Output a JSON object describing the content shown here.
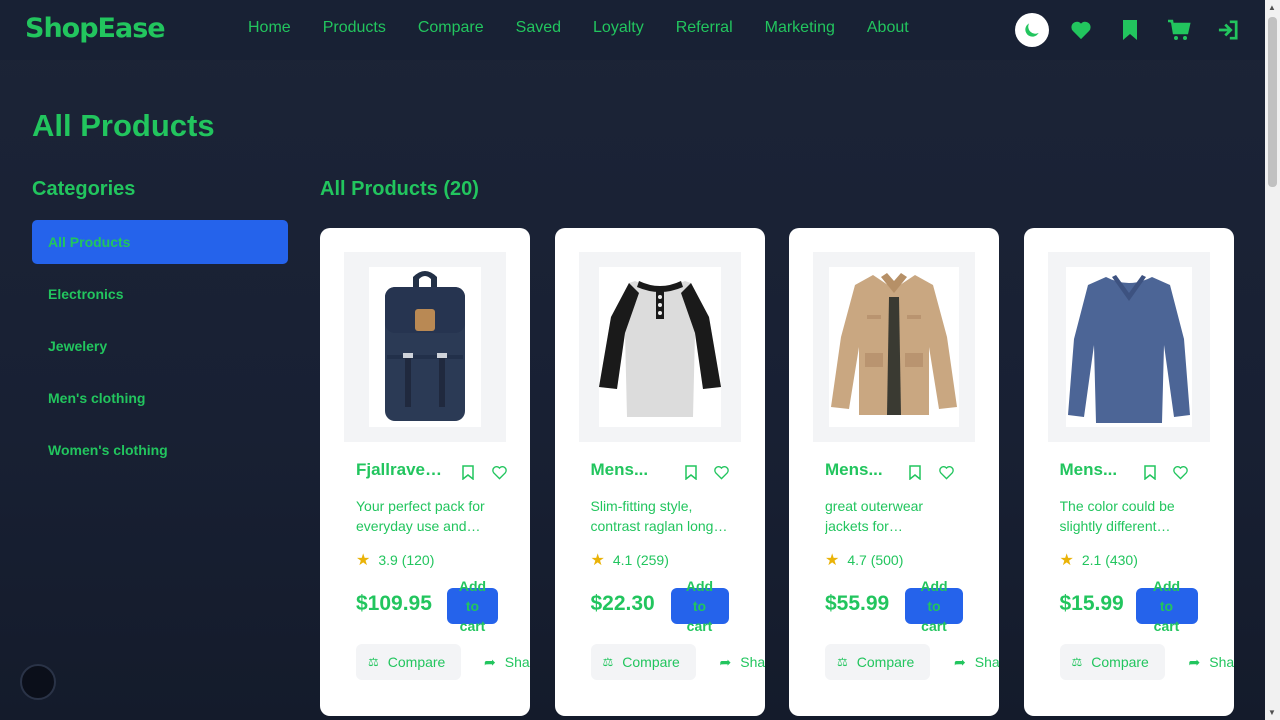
{
  "nav": {
    "logo": "ShopEase",
    "links": [
      "Home",
      "Products",
      "Compare",
      "Saved",
      "Loyalty",
      "Referral",
      "Marketing",
      "About"
    ],
    "icons": [
      "moon-icon",
      "heart-icon",
      "bookmark-icon",
      "cart-icon",
      "sign-in-icon"
    ]
  },
  "page": {
    "title": "All Products"
  },
  "sidebar": {
    "heading": "Categories",
    "items": [
      "All Products",
      "Electronics",
      "Jewelery",
      "Men's clothing",
      "Women's clothing"
    ],
    "active_index": 0
  },
  "products_heading": "All Products (20)",
  "products": [
    {
      "title": "Fjallraven...",
      "description": "Your perfect pack for everyday use and walks in the forest.",
      "rating": "3.9 (120)",
      "price": "$109.95",
      "image": "backpack"
    },
    {
      "title": "Mens...",
      "description": "Slim-fitting style, contrast raglan long sleeve, three-button henley placket.",
      "rating": "4.1 (259)",
      "price": "$22.30",
      "image": "raglan-tshirt"
    },
    {
      "title": "Mens...",
      "description": "great outerwear jackets for Spring/Autumn/Winter.",
      "rating": "4.7 (500)",
      "price": "$55.99",
      "image": "cotton-jacket"
    },
    {
      "title": "Mens...",
      "description": "The color could be slightly different between on the screen and in practice.",
      "rating": "2.1 (430)",
      "price": "$15.99",
      "image": "slim-fit-shirt"
    }
  ],
  "card_labels": {
    "add_to_cart": "Add to cart",
    "compare": "Compare",
    "share": "Share"
  },
  "colors": {
    "accent": "#22c55e",
    "primary": "#2563eb",
    "background": "#1c2437",
    "star": "#eab308"
  }
}
